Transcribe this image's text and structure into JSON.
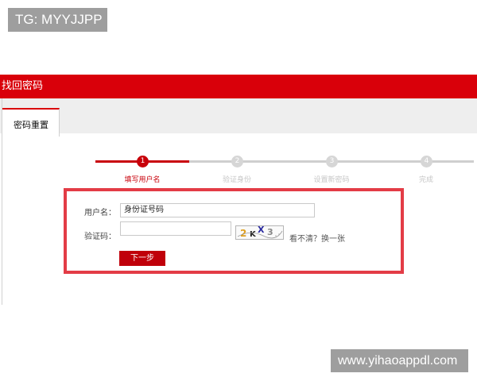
{
  "watermarks": {
    "top_left": "TG: MYYJJPP",
    "bottom_right": "www.yihaoappdl.com"
  },
  "header": {
    "title": "找回密码"
  },
  "tabs": [
    {
      "label": "密码重置",
      "active": true
    }
  ],
  "steps": [
    {
      "number": "1",
      "label": "填写用户名",
      "active": true
    },
    {
      "number": "2",
      "label": "验证身份",
      "active": false
    },
    {
      "number": "3",
      "label": "设置新密码",
      "active": false
    },
    {
      "number": "4",
      "label": "完成",
      "active": false
    }
  ],
  "form": {
    "username_label": "用户名：",
    "username_value": "身份证号码",
    "captcha_label": "验证码：",
    "captcha_value": "",
    "captcha_text": "2KX3",
    "refresh_link": "看不清？换一张",
    "next_button": "下一步"
  },
  "colors": {
    "brand_red": "#d9000a",
    "highlight_red": "#e33c46",
    "inactive_gray": "#cfcfcf"
  }
}
